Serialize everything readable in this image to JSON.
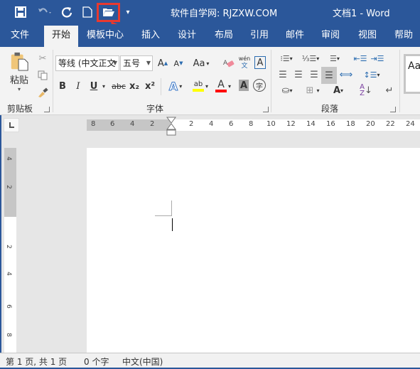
{
  "titlebar": {
    "site_text": "软件自学网: RJZXW.COM",
    "doc_title": "文档1  -  Word",
    "quick_access": [
      {
        "name": "save-icon",
        "glyph": "💾"
      },
      {
        "name": "undo-icon",
        "glyph": "↶"
      },
      {
        "name": "redo-icon",
        "glyph": "↻"
      },
      {
        "name": "new-document-icon",
        "glyph": "🗋"
      },
      {
        "name": "open-folder-icon",
        "glyph": "📂"
      },
      {
        "name": "customize-qat-icon",
        "glyph": "▾"
      }
    ]
  },
  "tabs": [
    {
      "label": "文件"
    },
    {
      "label": "开始",
      "active": true
    },
    {
      "label": "模板中心"
    },
    {
      "label": "插入"
    },
    {
      "label": "设计"
    },
    {
      "label": "布局"
    },
    {
      "label": "引用"
    },
    {
      "label": "邮件"
    },
    {
      "label": "审阅"
    },
    {
      "label": "视图"
    },
    {
      "label": "帮助"
    }
  ],
  "ribbon": {
    "clipboard": {
      "label": "剪贴板",
      "paste_label": "粘贴"
    },
    "font": {
      "label": "字体",
      "font_name": "等线 (中文正文",
      "font_size": "五号",
      "grow": "A",
      "shrink": "A",
      "case": "Aa",
      "bold": "B",
      "italic": "I",
      "underline": "U",
      "strike": "abc",
      "subscript": "x₂",
      "superscript": "x²",
      "phonetic_top": "wén",
      "phonetic_bottom": "文",
      "enclose": "字",
      "highlight_color": "#ffff00",
      "font_color": "#ff0000"
    },
    "paragraph": {
      "label": "段落"
    },
    "styles": {
      "preview": "Aa"
    }
  },
  "ruler": {
    "h_numbers_left": [
      "8",
      "6",
      "4",
      "2"
    ],
    "h_numbers_right": [
      "2",
      "4",
      "6",
      "8",
      "10",
      "12",
      "14",
      "16",
      "18",
      "20",
      "22",
      "24"
    ],
    "v_numbers": [
      "4",
      "2",
      "2",
      "4",
      "6",
      "8"
    ]
  },
  "status": {
    "page": "第 1 页, 共 1 页",
    "words": "0 个字",
    "language": "中文(中国)"
  },
  "annotation": {
    "highlight_color": "#e8392f"
  }
}
